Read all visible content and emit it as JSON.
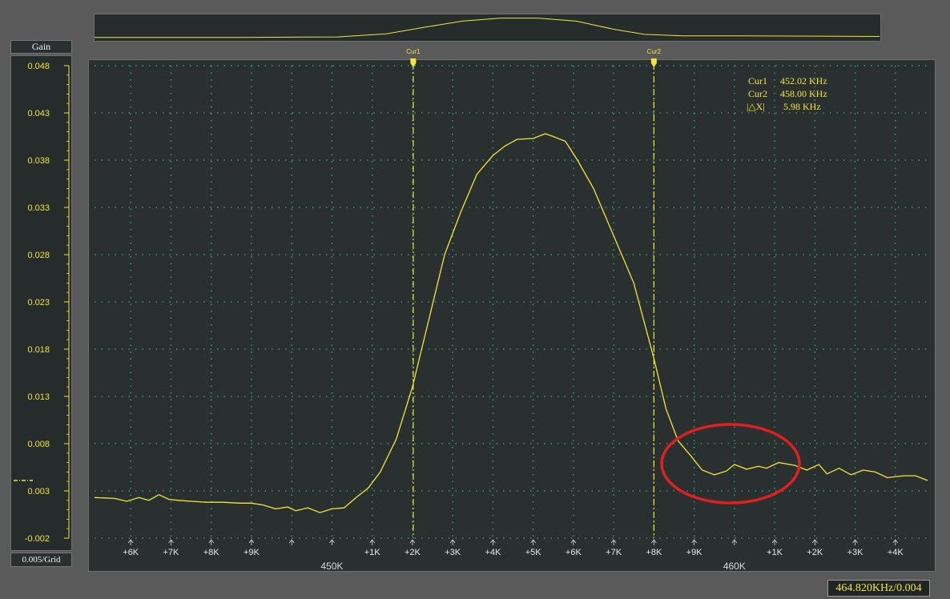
{
  "gain_header": "Gain",
  "scale_label": "0.005/Grid",
  "status": "464.820KHz/0.004",
  "colors": {
    "trace": "#f2e53a",
    "grid": "#33a89a",
    "annotation": "#e02020"
  },
  "cursors": {
    "cur1": {
      "tag": "Cur1",
      "label": "Cur1",
      "value": "452.02 KHz",
      "x_value": 452.02
    },
    "cur2": {
      "tag": "Cur2",
      "label": "Cur2",
      "value": "458.00 KHz",
      "x_value": 458.0
    },
    "delta": {
      "label": "|△X|",
      "value": "5.98 KHz"
    }
  },
  "chart_data": {
    "type": "line",
    "title": "",
    "xlabel": "",
    "ylabel": "Gain",
    "xlim": [
      444.1,
      464.8
    ],
    "ylim": [
      -0.002,
      0.048
    ],
    "grid": true,
    "y_ticks": [
      "0.048",
      "0.043",
      "0.038",
      "0.033",
      "0.028",
      "0.023",
      "0.018",
      "0.013",
      "0.008",
      "0.003",
      "-0.002"
    ],
    "x_ticks": [
      {
        "v": 445,
        "label": "+6K"
      },
      {
        "v": 446,
        "label": "+7K"
      },
      {
        "v": 447,
        "label": "+8K"
      },
      {
        "v": 448,
        "label": "+9K"
      },
      {
        "v": 449,
        "label": ""
      },
      {
        "v": 450,
        "label": ""
      },
      {
        "v": 451,
        "label": "+1K"
      },
      {
        "v": 452,
        "label": "+2K"
      },
      {
        "v": 453,
        "label": "+3K"
      },
      {
        "v": 454,
        "label": "+4K"
      },
      {
        "v": 455,
        "label": "+5K"
      },
      {
        "v": 456,
        "label": "+6K"
      },
      {
        "v": 457,
        "label": "+7K"
      },
      {
        "v": 458,
        "label": "+8K"
      },
      {
        "v": 459,
        "label": "+9K"
      },
      {
        "v": 460,
        "label": ""
      },
      {
        "v": 461,
        "label": "+1K"
      },
      {
        "v": 462,
        "label": "+2K"
      },
      {
        "v": 463,
        "label": "+3K"
      },
      {
        "v": 464,
        "label": "+4K"
      }
    ],
    "x_major_labels": [
      {
        "v": 450,
        "label": "450K"
      },
      {
        "v": 460,
        "label": "460K"
      }
    ],
    "series": [
      {
        "x": [
          444.1,
          444.6,
          444.9,
          445.2,
          445.45,
          445.7,
          445.95,
          446.2,
          446.5,
          446.9,
          447.3,
          447.7,
          448.0,
          448.3,
          448.6,
          448.9,
          449.1,
          449.4,
          449.7,
          450.0,
          450.3,
          450.6,
          450.9,
          451.2,
          451.6,
          452.0,
          452.4,
          452.8,
          453.2,
          453.6,
          454.0,
          454.3,
          454.6,
          455.0,
          455.3,
          455.5,
          455.8,
          456.1,
          456.5,
          457.0,
          457.5,
          458.0,
          458.3,
          458.6,
          458.9,
          459.2,
          459.5,
          459.8,
          460.0,
          460.3,
          460.6,
          460.8,
          461.1,
          461.5,
          461.8,
          462.1,
          462.3,
          462.6,
          462.9,
          463.2,
          463.5,
          463.8,
          464.2,
          464.5,
          464.8
        ],
        "y": [
          0.0023,
          0.0022,
          0.0019,
          0.0023,
          0.002,
          0.0026,
          0.0021,
          0.002,
          0.0019,
          0.0018,
          0.0018,
          0.0017,
          0.0017,
          0.0015,
          0.0011,
          0.0013,
          0.0009,
          0.0012,
          0.0007,
          0.0011,
          0.0012,
          0.0023,
          0.0033,
          0.005,
          0.0085,
          0.014,
          0.021,
          0.028,
          0.0325,
          0.0365,
          0.0385,
          0.0395,
          0.0402,
          0.0403,
          0.0408,
          0.0405,
          0.04,
          0.038,
          0.035,
          0.03,
          0.025,
          0.017,
          0.0117,
          0.0083,
          0.0068,
          0.0052,
          0.0047,
          0.0051,
          0.0058,
          0.0053,
          0.0056,
          0.0054,
          0.006,
          0.0057,
          0.0052,
          0.0058,
          0.0048,
          0.0054,
          0.0047,
          0.0052,
          0.005,
          0.0044,
          0.0046,
          0.0046,
          0.0041
        ]
      }
    ],
    "overview_series": {
      "x": [
        444.1,
        448,
        450.5,
        451.8,
        452.8,
        453.8,
        454.8,
        455.8,
        456.8,
        457.8,
        458.6,
        459.6,
        461,
        464.8
      ],
      "y": [
        0.002,
        0.002,
        0.003,
        0.009,
        0.022,
        0.034,
        0.04,
        0.04,
        0.034,
        0.018,
        0.008,
        0.005,
        0.005,
        0.004
      ]
    }
  }
}
